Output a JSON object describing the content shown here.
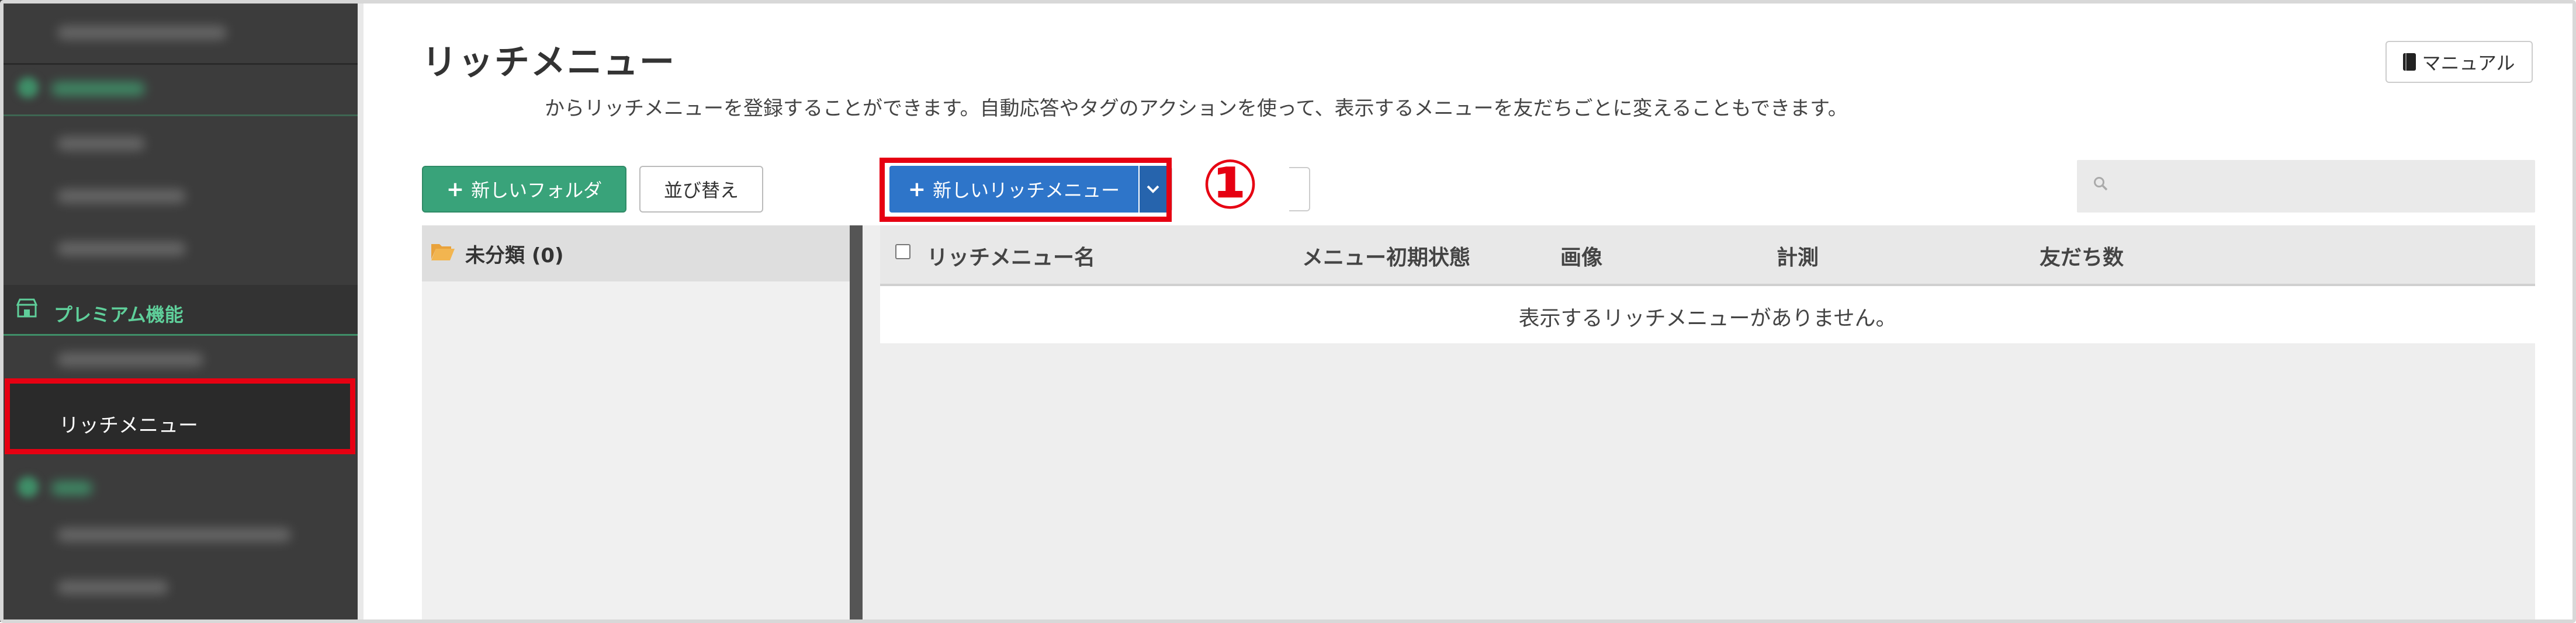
{
  "sidebar": {
    "premium_label": "プレミアム機能",
    "rich_menu_label": "リッチメニュー",
    "icons": {
      "premium": "store-icon"
    }
  },
  "header": {
    "title": "リッチメニュー",
    "description": "からリッチメニューを登録することができます。自動応答やタグのアクションを使って、表示するメニューを友だちごとに変えることもできます。",
    "manual_label": "マニュアル"
  },
  "toolbar": {
    "new_folder_label": "新しいフォルダ",
    "sort_label": "並び替え",
    "new_rich_menu_label": "新しいリッチメニュー",
    "annotation_number": "①"
  },
  "folders": [
    {
      "label": "未分類 (0)"
    }
  ],
  "table": {
    "columns": [
      "リッチメニュー名",
      "メニュー初期状態",
      "画像",
      "計測",
      "友だち数"
    ],
    "empty_message": "表示するリッチメニューがありません。"
  },
  "colors": {
    "sidebar_bg": "#3c3c3c",
    "accent_green": "#39a37a",
    "primary_blue": "#2e75c9",
    "highlight_red": "#e60012"
  }
}
